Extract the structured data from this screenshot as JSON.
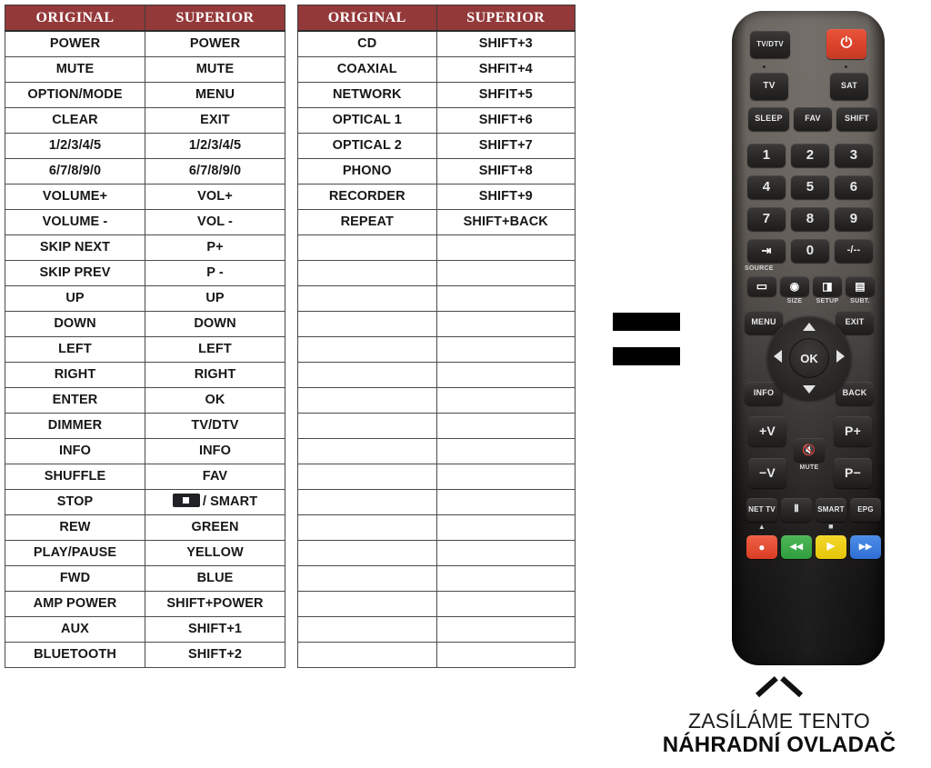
{
  "tables": {
    "headers": [
      "ORIGINAL",
      "SUPERIOR"
    ],
    "left": {
      "rows": [
        [
          "POWER",
          "POWER"
        ],
        [
          "MUTE",
          "MUTE"
        ],
        [
          "OPTION/MODE",
          "MENU"
        ],
        [
          "CLEAR",
          "EXIT"
        ],
        [
          "1/2/3/4/5",
          "1/2/3/4/5"
        ],
        [
          "6/7/8/9/0",
          "6/7/8/9/0"
        ],
        [
          "VOLUME+",
          "VOL+"
        ],
        [
          "VOLUME -",
          "VOL -"
        ],
        [
          "SKIP NEXT",
          "P+"
        ],
        [
          "SKIP PREV",
          "P -"
        ],
        [
          "UP",
          "UP"
        ],
        [
          "DOWN",
          "DOWN"
        ],
        [
          "LEFT",
          "LEFT"
        ],
        [
          "RIGHT",
          "RIGHT"
        ],
        [
          "ENTER",
          "OK"
        ],
        [
          "DIMMER",
          "TV/DTV"
        ],
        [
          "INFO",
          "INFO"
        ],
        [
          "SHUFFLE",
          "FAV"
        ],
        [
          "STOP",
          "■ / SMART"
        ],
        [
          "REW",
          "GREEN"
        ],
        [
          "PLAY/PAUSE",
          "YELLOW"
        ],
        [
          "FWD",
          "BLUE"
        ],
        [
          "AMP POWER",
          "SHIFT+POWER"
        ],
        [
          "AUX",
          "SHIFT+1"
        ],
        [
          "BLUETOOTH",
          "SHIFT+2"
        ]
      ]
    },
    "right": {
      "rows": [
        [
          "CD",
          "SHIFT+3"
        ],
        [
          "COAXIAL",
          "SHFIT+4"
        ],
        [
          "NETWORK",
          "SHFIT+5"
        ],
        [
          "OPTICAL 1",
          "SHIFT+6"
        ],
        [
          "OPTICAL 2",
          "SHIFT+7"
        ],
        [
          "PHONO",
          "SHIFT+8"
        ],
        [
          "RECORDER",
          "SHIFT+9"
        ],
        [
          "REPEAT",
          "SHIFT+BACK"
        ],
        [
          "",
          ""
        ],
        [
          "",
          ""
        ],
        [
          "",
          ""
        ],
        [
          "",
          ""
        ],
        [
          "",
          ""
        ],
        [
          "",
          ""
        ],
        [
          "",
          ""
        ],
        [
          "",
          ""
        ],
        [
          "",
          ""
        ],
        [
          "",
          ""
        ],
        [
          "",
          ""
        ],
        [
          "",
          ""
        ],
        [
          "",
          ""
        ],
        [
          "",
          ""
        ],
        [
          "",
          ""
        ],
        [
          "",
          ""
        ],
        [
          "",
          ""
        ]
      ]
    }
  },
  "equals_sign": {
    "name": "equals-symbol"
  },
  "remote": {
    "buttons": {
      "tvdtv": "TV/DTV",
      "power": "⏻",
      "tv": "TV",
      "sat": "SAT",
      "sleep": "SLEEP",
      "fav": "FAV",
      "shift": "SHIFT",
      "n1": "1",
      "n2": "2",
      "n3": "3",
      "n4": "4",
      "n5": "5",
      "n6": "6",
      "n7": "7",
      "n8": "8",
      "n9": "9",
      "source": "⇥",
      "n0": "0",
      "dash": "-/--",
      "source_label": "SOURCE",
      "aspect": "▭",
      "size": "◉",
      "size_label": "SIZE",
      "setup": "◨",
      "setup_label": "SETUP",
      "subt": "▤",
      "subt_label": "SUBT.",
      "menu": "MENU",
      "exit": "EXIT",
      "ok": "OK",
      "info": "INFO",
      "back": "BACK",
      "vol_up": "+V",
      "vol_down": "−V",
      "mute": "🔇",
      "mute_label": "MUTE",
      "prog_up": "P+",
      "prog_down": "P−",
      "nettv": "NET TV",
      "eject": "▲",
      "pause": "Ⅱ",
      "smart": "SMART",
      "stop": "■",
      "epg": "EPG",
      "record": "●",
      "rewind": "◀◀",
      "play": "▶",
      "forward": "▶▶"
    },
    "colors": {
      "power": "#da3d25",
      "red": "#ea4a2e",
      "green": "#36a444",
      "yellow": "#edcc10",
      "blue": "#3576d8"
    }
  },
  "caption": {
    "line1": "ZASÍLÁME TENTO",
    "line2": "NÁHRADNÍ OVLADAČ"
  }
}
